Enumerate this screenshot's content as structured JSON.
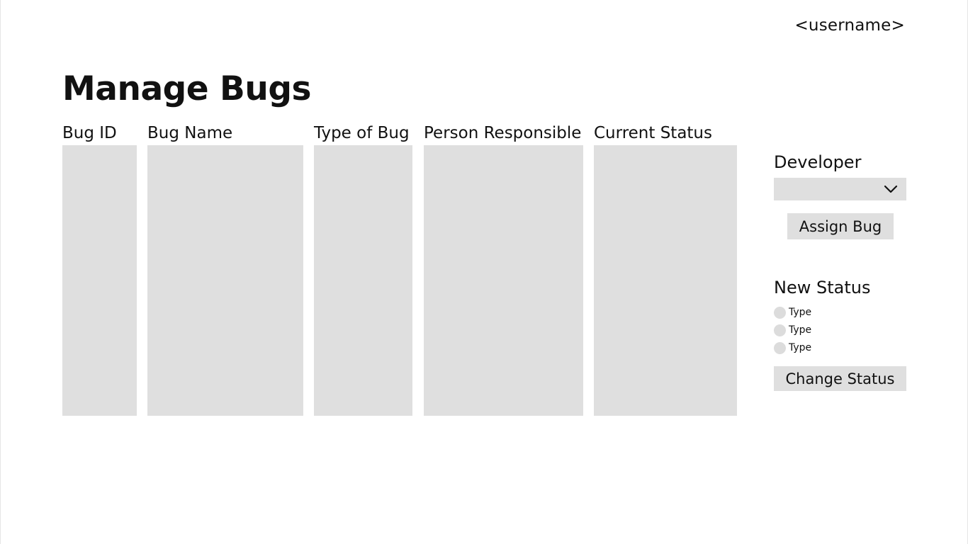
{
  "header": {
    "username": "<username>"
  },
  "page": {
    "title": "Manage Bugs"
  },
  "table": {
    "columns": [
      {
        "label": "Bug ID"
      },
      {
        "label": "Bug Name"
      },
      {
        "label": "Type of Bug"
      },
      {
        "label": "Person Responsible"
      },
      {
        "label": "Current Status"
      }
    ]
  },
  "assign_panel": {
    "developer_label": "Developer",
    "developer_selected": "",
    "assign_button": "Assign Bug"
  },
  "status_panel": {
    "new_status_label": "New Status",
    "options": [
      {
        "label": "Type"
      },
      {
        "label": "Type"
      },
      {
        "label": "Type"
      }
    ],
    "change_button": "Change Status"
  },
  "icons": {
    "dropdown": "chevron-down-icon"
  },
  "colors": {
    "placeholder_fill": "#dfdfdf",
    "text": "#111111"
  }
}
